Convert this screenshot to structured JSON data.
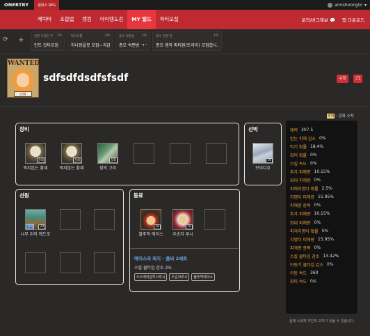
{
  "topbar": {
    "brand": "ONERTRY",
    "game_tab": "원피스 RPG",
    "username": "armshirongto"
  },
  "nav": {
    "items": [
      "캐릭터",
      "조합법",
      "랭킹",
      "아이템도감",
      "MY 빌드",
      "파티모집"
    ],
    "active": "MY 빌드",
    "right": [
      "문의/버그제보",
      "앱 다운로드"
    ]
  },
  "notices": [
    {
      "tag": "인원 드래곤 주",
      "count": "1/6",
      "text": "인트 핫타모집"
    },
    {
      "tag": "파스티를",
      "count": "2/6",
      "text": "하나장을못 모집~괴감~"
    },
    {
      "tag": "종오 속편방",
      "count": "2/6",
      "text": "종오 속편방 ㄱㄱ"
    },
    {
      "tag": "종오 관절 완",
      "count": "1/6",
      "text": "종오 앱작 파티원(트라이) 모집합니..."
    }
  ],
  "profile": {
    "wanted": "WANTED",
    "character_name": "나미",
    "build_title": "sdfsdfdsdfsfsdf",
    "edit_label": "수정"
  },
  "legend": {
    "badge": "조작",
    "label": ": 강화 수치"
  },
  "equipment": {
    "title": "장비",
    "slots": [
      {
        "name": "죽지않는 황제",
        "level": "강화"
      },
      {
        "name": "죽지않는 황제",
        "level": "강화"
      },
      {
        "name": "힘의 고리",
        "level": "강화"
      }
    ]
  },
  "ship": {
    "title": "선박",
    "slot": {
      "name": "모비디호",
      "level": "10"
    }
  },
  "crew": {
    "title": "선원",
    "slot": {
      "name": "나무 위의 해드로",
      "level": "20",
      "badge": "강화"
    }
  },
  "companions": {
    "title": "동료",
    "slots": [
      {
        "name": "불주먹 에이스",
        "level": "10"
      },
      {
        "name": "우승자 루시",
        "level": "10"
      }
    ],
    "set_name": "에이스의 의지 - 콤비 2세트",
    "set_desc": "스킬 쿨타임 감소 2%",
    "tags": [
      "수수께끼검투사루시",
      "우승자루시",
      "불주먹에이스"
    ]
  },
  "stats": [
    {
      "label": "체력",
      "value": "307.5"
    },
    {
      "label": "받는 피해 감소",
      "value": "0%"
    },
    {
      "label": "막기 확률",
      "value": "18.4%"
    },
    {
      "label": "회피 확률",
      "value": "0%"
    },
    {
      "label": "스킬 속도",
      "value": "0%"
    },
    {
      "label": "추가 피해량",
      "value": "10.15%"
    },
    {
      "label": "최대 피해량",
      "value": "0%"
    },
    {
      "label": "피해치명타 확률",
      "value": "2.5%"
    },
    {
      "label": "치명타 피해량",
      "value": "15.95%"
    },
    {
      "label": "피해량 증폭",
      "value": "0%"
    },
    {
      "label": "추가 피해량",
      "value": "10.15%"
    },
    {
      "label": "최대 피해량",
      "value": "0%"
    },
    {
      "label": "피격치명타 확률",
      "value": "5%"
    },
    {
      "label": "치명타 피해량",
      "value": "15.95%"
    },
    {
      "label": "피격량 증폭",
      "value": "0%"
    },
    {
      "label": "스킬 쿨타임 감소",
      "value": "13.42%"
    },
    {
      "label": "아동기 쿨타임 감소",
      "value": "0%"
    },
    {
      "label": "이동 속도",
      "value": "360"
    },
    {
      "label": "회피 속도",
      "value": "0/s"
    }
  ],
  "footnote": "실제 스탯과 약간의 오차가 있을 수 있습니다."
}
